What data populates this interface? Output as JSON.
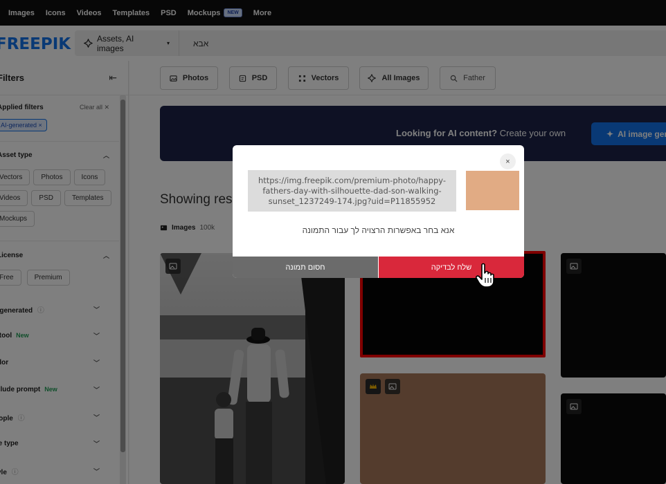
{
  "topnav": {
    "items": [
      "Images",
      "Icons",
      "Videos",
      "Templates",
      "PSD",
      "Mockups",
      "More"
    ],
    "badge": "NEW"
  },
  "header": {
    "logo": "FREEPIK",
    "asset_select": "Assets, AI images",
    "search_value": "אבא"
  },
  "sidebar": {
    "title": "Filters",
    "applied_filters": "Applied filters",
    "clear_all": "Clear all",
    "active_chip": "AI-generated",
    "asset_type": "Asset type",
    "asset_chips": [
      "Vectors",
      "Photos",
      "Icons",
      "Videos",
      "PSD",
      "Templates",
      "Mockups"
    ],
    "license": "License",
    "license_chips": [
      "Free",
      "Premium"
    ],
    "rows": [
      {
        "label": "AI-generated",
        "info": true,
        "new": false
      },
      {
        "label": "AI tool",
        "info": false,
        "new": true
      },
      {
        "label": "Color",
        "info": false,
        "new": false
      },
      {
        "label": "Include prompt",
        "info": false,
        "new": true
      },
      {
        "label": "People",
        "info": true,
        "new": false
      },
      {
        "label": "File type",
        "info": false,
        "new": false
      },
      {
        "label": "Style",
        "info": true,
        "new": false
      }
    ],
    "new_label": "New"
  },
  "filterbar": {
    "photos": "Photos",
    "psd": "PSD",
    "vectors": "Vectors",
    "all_images": "All Images",
    "search_term": "Father"
  },
  "main": {
    "banner_bold": "Looking for AI content?",
    "banner_rest": "Create your own",
    "banner_button": "AI image generator",
    "showing": "Showing results",
    "images_label": "Images",
    "images_count": "100k"
  },
  "modal": {
    "url": "https://img.freepik.com/premium-photo/happy-fathers-day-with-silhouette-dad-son-walking-sunset_1237249-174.jpg?uid=P11855952",
    "swatch_color": "#e1ab84",
    "message": "אנא בחר באפשרות הרצויה לך עבור התמונה",
    "block_button": "חסום תמונה",
    "send_button": "שלח לבדיקה",
    "close": "×"
  }
}
